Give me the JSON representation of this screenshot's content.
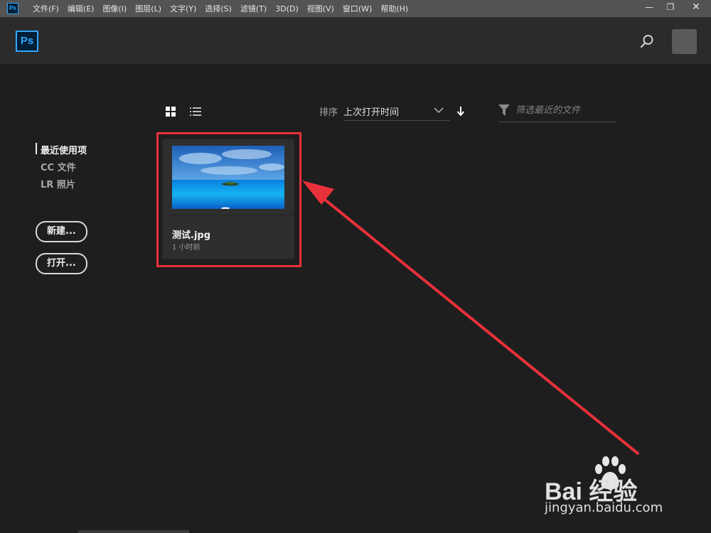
{
  "menubar": {
    "app_icon": "Ps",
    "items": [
      "文件(F)",
      "编辑(E)",
      "图像(I)",
      "图层(L)",
      "文字(Y)",
      "选择(S)",
      "滤镜(T)",
      "3D(D)",
      "视图(V)",
      "窗口(W)",
      "帮助(H)"
    ],
    "window_controls": {
      "minimize": "—",
      "restore": "❐",
      "close": "✕"
    }
  },
  "header": {
    "logo": "Ps",
    "search_icon": "search-icon",
    "avatar_icon": "avatar"
  },
  "sidebar": {
    "items": [
      {
        "label": "最近使用项",
        "active": true
      },
      {
        "label": "CC 文件",
        "active": false
      },
      {
        "label": "LR 照片",
        "active": false
      }
    ],
    "new_button": "新建...",
    "open_button": "打开..."
  },
  "toolbar": {
    "grid_view_icon": "grid-view-icon",
    "list_view_icon": "list-view-icon",
    "sort_label": "排序",
    "sort_value": "上次打开时间",
    "sort_direction_icon": "arrow-down-icon",
    "filter_placeholder": "筛选最近的文件"
  },
  "files": [
    {
      "name": "测试.jpg",
      "time": "1 小时前"
    }
  ],
  "colors": {
    "accent": "#31a8ff",
    "annotation": "#e8313a",
    "background": "#1e1e1e",
    "header": "#2b2b2b",
    "menubar": "#535353"
  },
  "watermark": {
    "brand": "Bai 经验",
    "url": "jingyan.baidu.com"
  }
}
